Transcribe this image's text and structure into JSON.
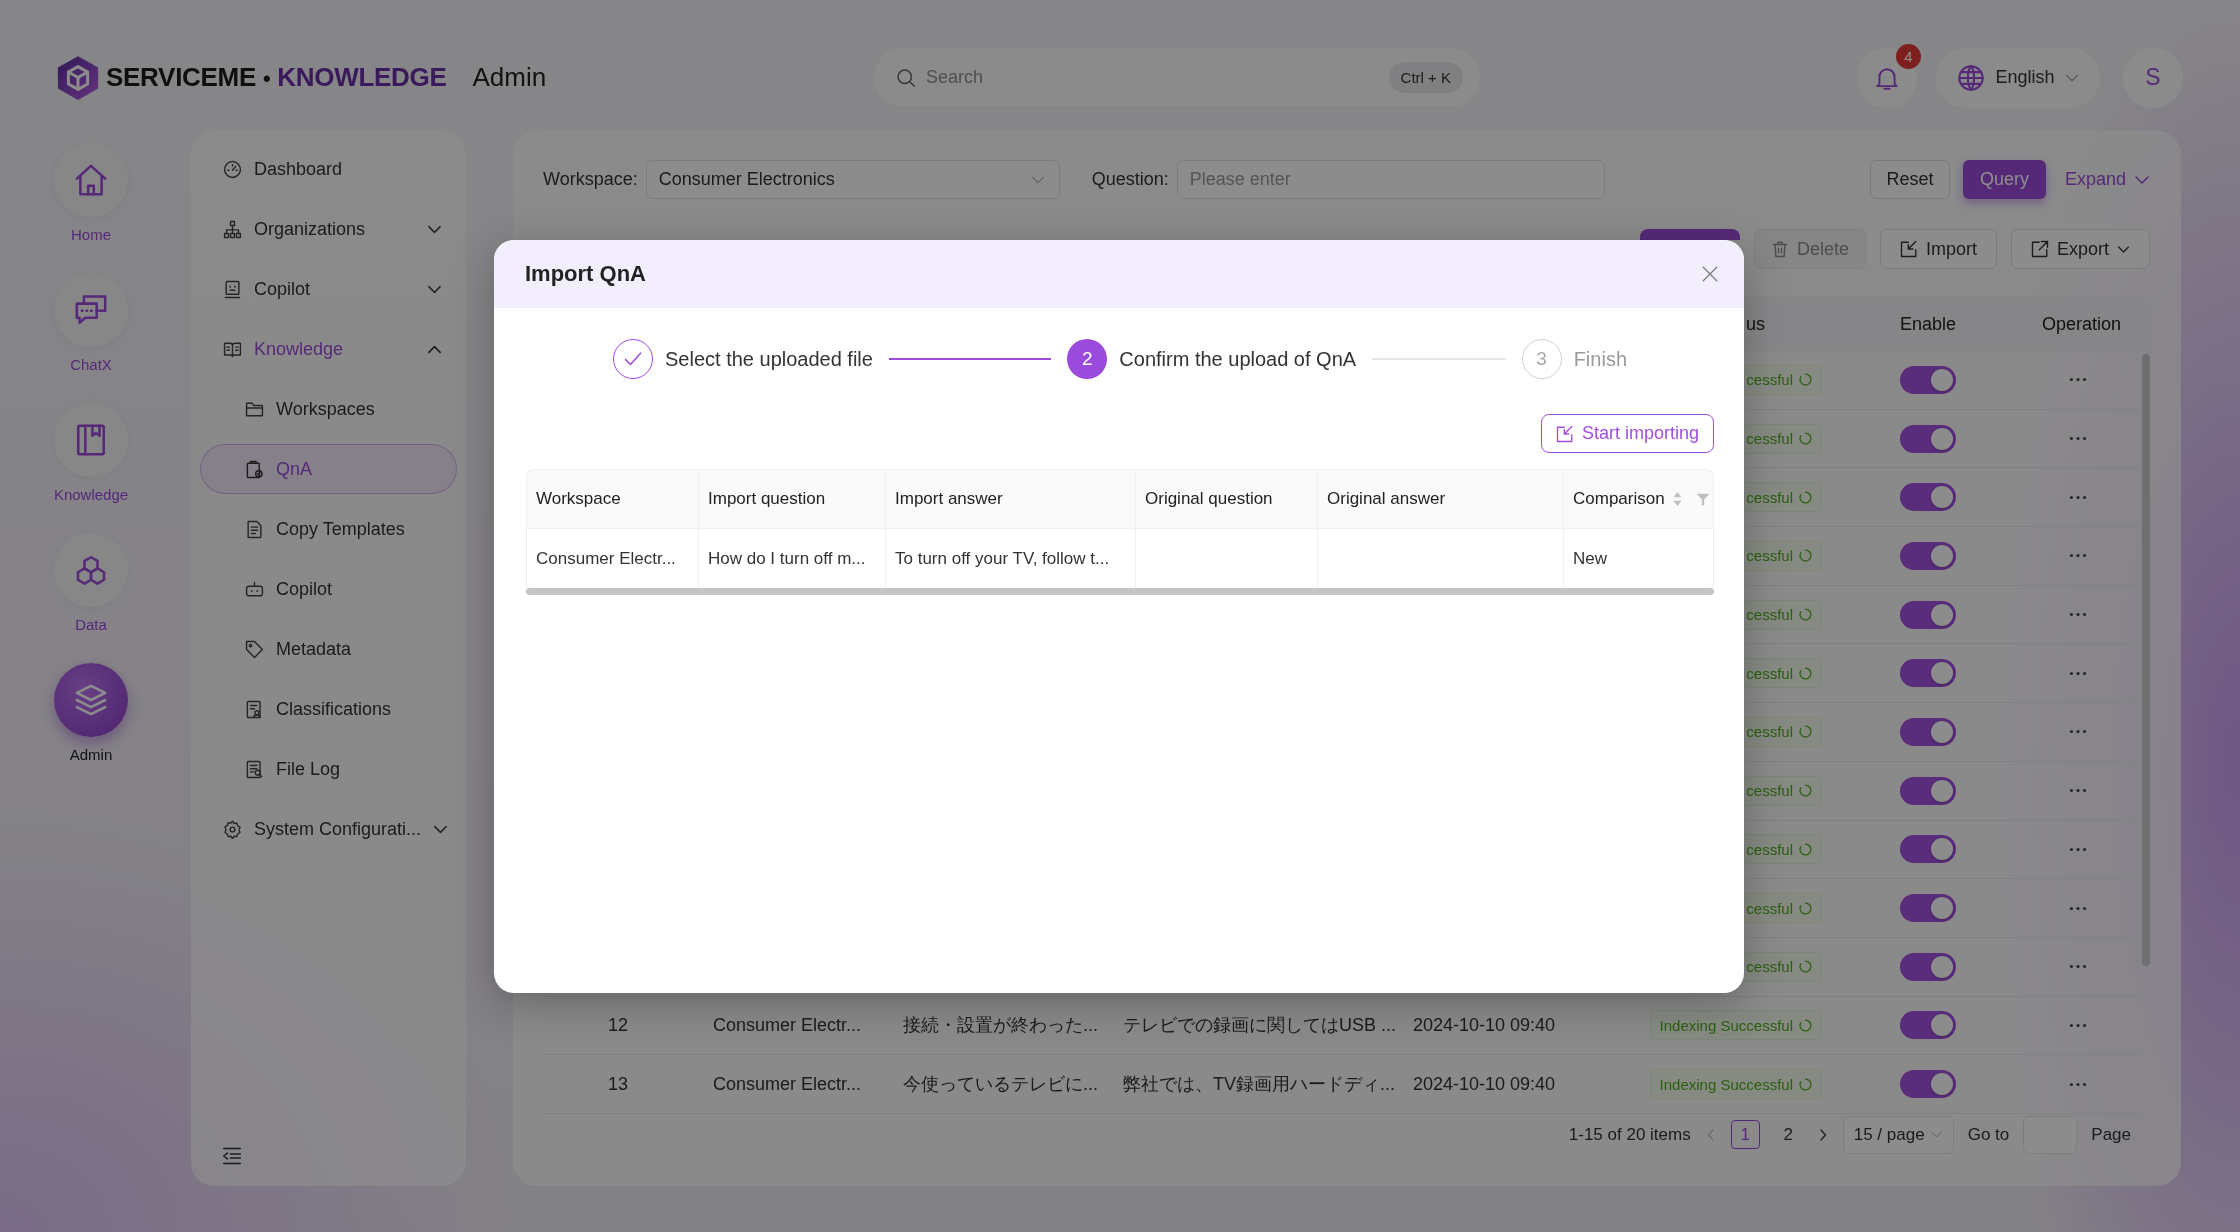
{
  "header": {
    "logo": {
      "brand": "SERVICEME",
      "separator": "•",
      "product": "KNOWLEDGE"
    },
    "title": "Admin",
    "search": {
      "placeholder": "Search",
      "shortcut": "Ctrl + K"
    },
    "notifications": {
      "count": "4"
    },
    "language": {
      "label": "English"
    },
    "avatar": {
      "initial": "S"
    }
  },
  "rail": [
    {
      "label": "Home",
      "selected": false
    },
    {
      "label": "ChatX",
      "selected": false
    },
    {
      "label": "Knowledge",
      "selected": false
    },
    {
      "label": "Data",
      "selected": false
    },
    {
      "label": "Admin",
      "selected": true
    }
  ],
  "sidebar": {
    "items": [
      {
        "label": "Dashboard",
        "selected": false
      },
      {
        "label": "Organizations",
        "selected": false,
        "expanded": false
      },
      {
        "label": "Copilot",
        "selected": false,
        "expanded": false
      },
      {
        "label": "Knowledge",
        "selected": false,
        "expanded": true,
        "children": [
          {
            "label": "Workspaces",
            "selected": false
          },
          {
            "label": "QnA",
            "selected": true
          },
          {
            "label": "Copy Templates",
            "selected": false
          },
          {
            "label": "Copilot",
            "selected": false
          },
          {
            "label": "Metadata",
            "selected": false
          },
          {
            "label": "Classifications",
            "selected": false
          },
          {
            "label": "File Log",
            "selected": false
          }
        ]
      },
      {
        "label": "System Configurati...",
        "selected": false,
        "expanded": false
      }
    ]
  },
  "filters": {
    "fields": [
      {
        "kind": "select",
        "label": "Workspace:",
        "value": "Consumer Electronics"
      },
      {
        "kind": "input",
        "label": "Question:",
        "placeholder": "Please enter"
      }
    ],
    "actions": [
      {
        "kind": "default",
        "label": "Reset"
      },
      {
        "kind": "primary",
        "label": "Query"
      },
      {
        "kind": "link",
        "label": "Expand"
      }
    ]
  },
  "toolbar": [
    {
      "kind": "primary",
      "disabled": false
    },
    {
      "kind": "delete",
      "label": "Delete",
      "disabled": true
    },
    {
      "kind": "import",
      "label": "Import",
      "disabled": false
    },
    {
      "kind": "export",
      "label": "Export",
      "disabled": false
    }
  ],
  "table": {
    "columns": [
      {
        "title": "us"
      },
      {
        "title": "Enable"
      },
      {
        "title": "Operation"
      }
    ],
    "rows": [
      {
        "column_6": "cessful",
        "enabled": true
      },
      {
        "column_6": "cessful",
        "enabled": true
      },
      {
        "column_6": "cessful",
        "enabled": true
      },
      {
        "column_6": "cessful",
        "enabled": true
      },
      {
        "column_6": "cessful",
        "enabled": true
      },
      {
        "column_6": "cessful",
        "enabled": true
      },
      {
        "column_6": "cessful",
        "enabled": true
      },
      {
        "column_6": "cessful",
        "enabled": true
      },
      {
        "column_6": "cessful",
        "enabled": true
      },
      {
        "column_6": "cessful",
        "enabled": true
      },
      {
        "column_6": "cessful",
        "enabled": true
      },
      {
        "column_1": "12",
        "column_2": "Consumer Electr...",
        "column_3": "接続・設置が終わった...",
        "column_4": "テレビでの録画に関してはUSB ...",
        "column_5": "2024-10-10 09:40",
        "column_6": "Indexing Successful",
        "enabled": true
      },
      {
        "column_1": "13",
        "column_2": "Consumer Electr...",
        "column_3": "今使っているテレビに...",
        "column_4": "弊社では、TV録画用ハードディ...",
        "column_5": "2024-10-10 09:40",
        "column_6": "Indexing Successful",
        "enabled": true
      }
    ]
  },
  "pagination": {
    "summary": "1-15 of 20 items",
    "previous": {
      "disabled": true
    },
    "pages": [
      {
        "label": "1",
        "selected": true
      },
      {
        "label": "2",
        "selected": false
      }
    ],
    "next": {
      "disabled": false
    },
    "page_size": "15 / page",
    "goto_label": "Go to",
    "page_label": "Page"
  },
  "import_dialog": {
    "title": "Import QnA",
    "steps": [
      {
        "label": "Select the uploaded file",
        "done": true,
        "current": false
      },
      {
        "number": "2",
        "label": "Confirm the upload of QnA",
        "done": false,
        "current": true
      },
      {
        "number": "3",
        "label": "Finish",
        "done": false,
        "current": false
      }
    ],
    "action": {
      "label": "Start importing"
    },
    "preview_table": {
      "columns": [
        {
          "title": "Workspace",
          "sortable": false,
          "filterable": false
        },
        {
          "title": "Import question",
          "sortable": false,
          "filterable": false
        },
        {
          "title": "Import answer",
          "sortable": false,
          "filterable": false
        },
        {
          "title": "Original question",
          "sortable": false,
          "filterable": false
        },
        {
          "title": "Original answer",
          "sortable": false,
          "filterable": false
        },
        {
          "title": "Comparison",
          "sortable": true,
          "filterable": true
        }
      ],
      "rows": [
        {
          "column_1": "Consumer Electr...",
          "column_2": "How do I turn off m...",
          "column_3": "To turn off your TV, follow t...",
          "column_6": "New"
        }
      ]
    }
  }
}
